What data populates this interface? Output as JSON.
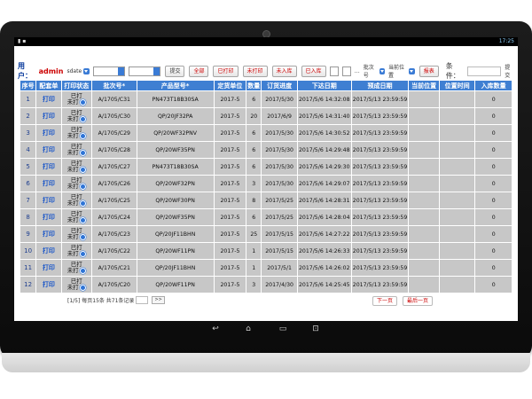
{
  "status": {
    "time": "17:25"
  },
  "toolbar": {
    "user_label": "用户：",
    "user_name": "admin",
    "select_value": "sdate",
    "buttons": [
      {
        "label": "提交"
      },
      {
        "label": "全部"
      },
      {
        "label": "已打印"
      },
      {
        "label": "未打印"
      },
      {
        "label": "未入库"
      },
      {
        "label": "已入库"
      }
    ],
    "dash": "…",
    "batch_select": "批次号",
    "location_select": "当前位置",
    "report_label": "报表",
    "condition_label": "条件：",
    "submit2_label": "提交"
  },
  "table": {
    "headers": [
      "序号",
      "配套单",
      "打印状态",
      "批次号*",
      "产品型号*",
      "定货单位",
      "数量",
      "订货进度",
      "下达日期",
      "预成日期",
      "当前位置",
      "位置时间",
      "入库数量"
    ],
    "print_label": "打印",
    "status_printed": "已打",
    "status_unprinted": "未打",
    "rows": [
      {
        "seq": "1",
        "batch": "A/1705/C31",
        "model": "PN473T18B30SA",
        "unit": "2017-5",
        "qty": "6",
        "progress": "2017/5/30",
        "issue": "2017/5/6 14:32:08",
        "due": "2017/5/13 23:59:59",
        "in": "0"
      },
      {
        "seq": "2",
        "batch": "A/1705/C30",
        "model": "QP/20JF32PA",
        "unit": "2017-5",
        "qty": "20",
        "progress": "2017/6/9",
        "issue": "2017/5/6 14:31:40",
        "due": "2017/5/13 23:59:59",
        "in": "0"
      },
      {
        "seq": "3",
        "batch": "A/1705/C29",
        "model": "QP/20WF32PNV",
        "unit": "2017-5",
        "qty": "6",
        "progress": "2017/5/30",
        "issue": "2017/5/6 14:30:52",
        "due": "2017/5/13 23:59:59",
        "in": "0"
      },
      {
        "seq": "4",
        "batch": "A/1705/C28",
        "model": "QP/20WF35PN",
        "unit": "2017-5",
        "qty": "6",
        "progress": "2017/5/30",
        "issue": "2017/5/6 14:29:48",
        "due": "2017/5/13 23:59:59",
        "in": "0"
      },
      {
        "seq": "5",
        "batch": "A/1705/C27",
        "model": "PN473T18B30SA",
        "unit": "2017-5",
        "qty": "6",
        "progress": "2017/5/30",
        "issue": "2017/5/6 14:29:30",
        "due": "2017/5/13 23:59:59",
        "in": "0"
      },
      {
        "seq": "6",
        "batch": "A/1705/C26",
        "model": "QP/20WF32PN",
        "unit": "2017-5",
        "qty": "3",
        "progress": "2017/5/30",
        "issue": "2017/5/6 14:29:07",
        "due": "2017/5/13 23:59:59",
        "in": "0"
      },
      {
        "seq": "7",
        "batch": "A/1705/C25",
        "model": "QP/20WF30PN",
        "unit": "2017-5",
        "qty": "8",
        "progress": "2017/5/25",
        "issue": "2017/5/6 14:28:31",
        "due": "2017/5/13 23:59:59",
        "in": "0"
      },
      {
        "seq": "8",
        "batch": "A/1705/C24",
        "model": "QP/20WF35PN",
        "unit": "2017-5",
        "qty": "6",
        "progress": "2017/5/25",
        "issue": "2017/5/6 14:28:04",
        "due": "2017/5/13 23:59:59",
        "in": "0"
      },
      {
        "seq": "9",
        "batch": "A/1705/C23",
        "model": "QP/20JF11BHN",
        "unit": "2017-5",
        "qty": "25",
        "progress": "2017/5/15",
        "issue": "2017/5/6 14:27:22",
        "due": "2017/5/13 23:59:59",
        "in": "0"
      },
      {
        "seq": "10",
        "batch": "A/1705/C22",
        "model": "QP/20WF11PN",
        "unit": "2017-5",
        "qty": "1",
        "progress": "2017/5/15",
        "issue": "2017/5/6 14:26:33",
        "due": "2017/5/13 23:59:59",
        "in": "0"
      },
      {
        "seq": "11",
        "batch": "A/1705/C21",
        "model": "QP/20JF11BHN",
        "unit": "2017-5",
        "qty": "1",
        "progress": "2017/5/1",
        "issue": "2017/5/6 14:26:02",
        "due": "2017/5/13 23:59:59",
        "in": "0"
      },
      {
        "seq": "12",
        "batch": "A/1705/C20",
        "model": "QP/20WF11PN",
        "unit": "2017-5",
        "qty": "3",
        "progress": "2017/4/30",
        "issue": "2017/5/6 14:25:45",
        "due": "2017/5/13 23:59:59",
        "in": "0"
      }
    ]
  },
  "footer": {
    "page_info": "[1/5] 每页15条 共71条记录",
    "go_label": ">>",
    "next_label": "下一页",
    "last_label": "最后一页"
  },
  "icons": {
    "back": "back-icon",
    "home": "home-icon",
    "recent": "recent-apps-icon",
    "screenshot": "screenshot-icon"
  },
  "colors": {
    "header_bg": "#3f7fd2",
    "cell_bg": "#c7c7c7",
    "accent_red": "#cc0000",
    "link_blue": "#1a56c8"
  }
}
